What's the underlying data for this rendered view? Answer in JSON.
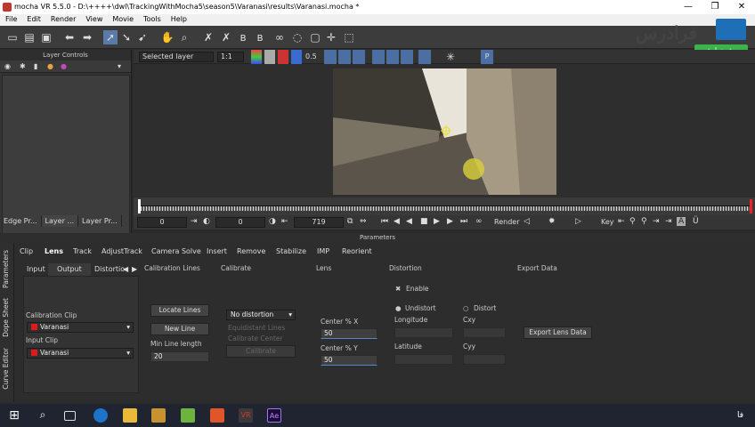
{
  "window": {
    "title": "mocha VR 5.5.0 - D:\\++++\\dwl\\TrackingWithMocha5\\season5\\Varanasi\\results\\Varanasi.mocha *"
  },
  "menu": [
    "File",
    "Edit",
    "Render",
    "View",
    "Movie",
    "Tools",
    "Help"
  ],
  "logo": {
    "brand": "فرادرس",
    "tag": "پیش نمایش"
  },
  "layer_panel": {
    "header": "Layer Controls",
    "tabs": [
      "Edge Pr...",
      "Layer ...",
      "Layer Pr..."
    ]
  },
  "viewbar": {
    "layer_select": "Selected layer",
    "zoom": "1:1",
    "opacity": "0.5",
    "p_label": "P"
  },
  "transport": {
    "start": "0",
    "current": "0",
    "end": "719",
    "render_label": "Render",
    "key_label": "Key"
  },
  "params_header": "Parameters",
  "side_tabs": [
    "Parameters",
    "Dope Sheet",
    "Curve Editor"
  ],
  "param_tabs": [
    "Clip",
    "Lens",
    "Track",
    "AdjustTrack",
    "Camera Solve",
    "Insert",
    "Remove",
    "Stabilize",
    "IMP",
    "Reorient"
  ],
  "sub_tabs": [
    "Input",
    "Output",
    "Distortio"
  ],
  "clip": {
    "cal_clip_label": "Calibration Clip",
    "cal_clip_value": "Varanasi",
    "input_clip_label": "Input Clip",
    "input_clip_value": "Varanasi"
  },
  "calibration_lines": {
    "header": "Calibration Lines",
    "locate": "Locate Lines",
    "new_line": "New Line",
    "min_len_label": "Min Line length",
    "min_len_value": "20"
  },
  "calibrate": {
    "header": "Calibrate",
    "distortion_select": "No distortion",
    "opt1": "Equidistant Lines",
    "opt2": "Calibrate Center",
    "calibrate_btn": "Calibrate"
  },
  "lens": {
    "header": "Lens",
    "cx_label": "Center % X",
    "cx_value": "50",
    "cy_label": "Center % Y",
    "cy_value": "50"
  },
  "distortion": {
    "header": "Distortion",
    "enable": "Enable",
    "undistort": "Undistort",
    "distort": "Distort",
    "longitude": "Longitude",
    "latitude": "Latitude",
    "cxy": "Cxy",
    "cyy": "Cyy"
  },
  "export": {
    "header": "Export Data",
    "button": "Export Lens Data"
  },
  "taskbar": {
    "lang": "فا"
  }
}
